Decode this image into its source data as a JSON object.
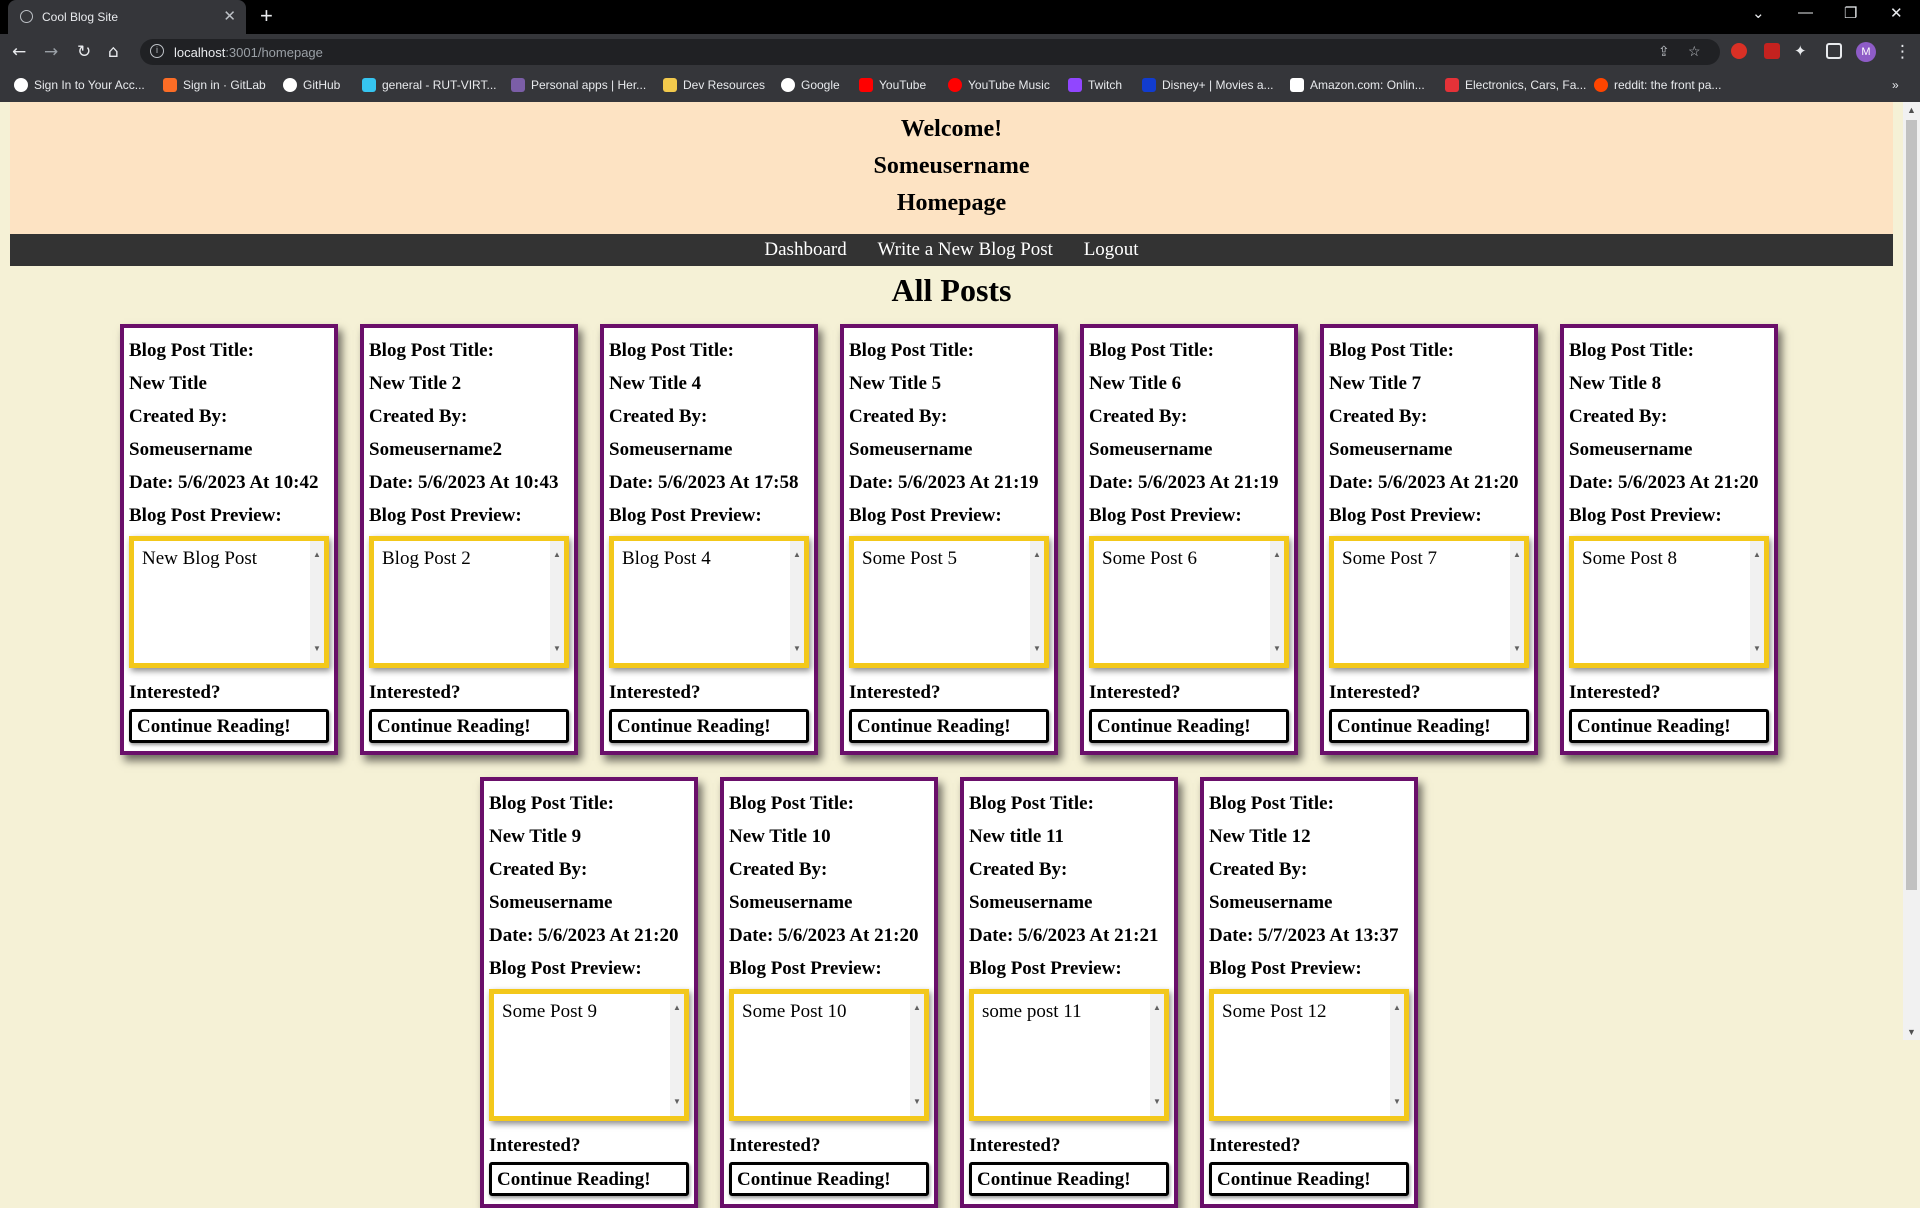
{
  "browser": {
    "tab_title": "Cool Blog Site",
    "url_host": "localhost",
    "url_path": ":3001/homepage",
    "profile_initial": "M",
    "bookmarks": [
      "Sign In to Your Acc...",
      "Sign in · GitLab",
      "GitHub",
      "general - RUT-VIRT...",
      "Personal apps | Her...",
      "Dev Resources",
      "Google",
      "YouTube",
      "YouTube Music",
      "Twitch",
      "Disney+ | Movies a...",
      "Amazon.com: Onlin...",
      "Electronics, Cars, Fa...",
      "reddit: the front pa..."
    ]
  },
  "header": {
    "line1": "Welcome!",
    "line2": "Someusername",
    "line3": "Homepage"
  },
  "nav": {
    "dashboard": "Dashboard",
    "write": "Write a New Blog Post",
    "logout": "Logout"
  },
  "section_title": "All Posts",
  "labels": {
    "title": "Blog Post Title:",
    "created": "Created By:",
    "preview": "Blog Post Preview:",
    "interested": "Interested?",
    "continue": "Continue Reading!"
  },
  "posts": [
    {
      "title": "New Title",
      "author": "Someusername",
      "date": "Date: 5/6/2023 At 10:42",
      "preview": "New Blog Post"
    },
    {
      "title": "New Title 2",
      "author": "Someusername2",
      "date": "Date: 5/6/2023 At 10:43",
      "preview": "Blog Post 2"
    },
    {
      "title": "New Title 4",
      "author": "Someusername",
      "date": "Date: 5/6/2023 At 17:58",
      "preview": "Blog Post 4"
    },
    {
      "title": "New Title 5",
      "author": "Someusername",
      "date": "Date: 5/6/2023 At 21:19",
      "preview": "Some Post 5"
    },
    {
      "title": "New Title 6",
      "author": "Someusername",
      "date": "Date: 5/6/2023 At 21:19",
      "preview": "Some Post 6"
    },
    {
      "title": "New Title 7",
      "author": "Someusername",
      "date": "Date: 5/6/2023 At 21:20",
      "preview": "Some Post 7"
    },
    {
      "title": "New Title 8",
      "author": "Someusername",
      "date": "Date: 5/6/2023 At 21:20",
      "preview": "Some Post 8"
    },
    {
      "title": "New Title 9",
      "author": "Someusername",
      "date": "Date: 5/6/2023 At 21:20",
      "preview": "Some Post 9"
    },
    {
      "title": "New Title 10",
      "author": "Someusername",
      "date": "Date: 5/6/2023 At 21:20",
      "preview": "Some Post 10"
    },
    {
      "title": "New title 11",
      "author": "Someusername",
      "date": "Date: 5/6/2023 At 21:21",
      "preview": "some post 11"
    },
    {
      "title": "New Title 12",
      "author": "Someusername",
      "date": "Date: 5/7/2023 At 13:37",
      "preview": "Some Post 12"
    }
  ]
}
